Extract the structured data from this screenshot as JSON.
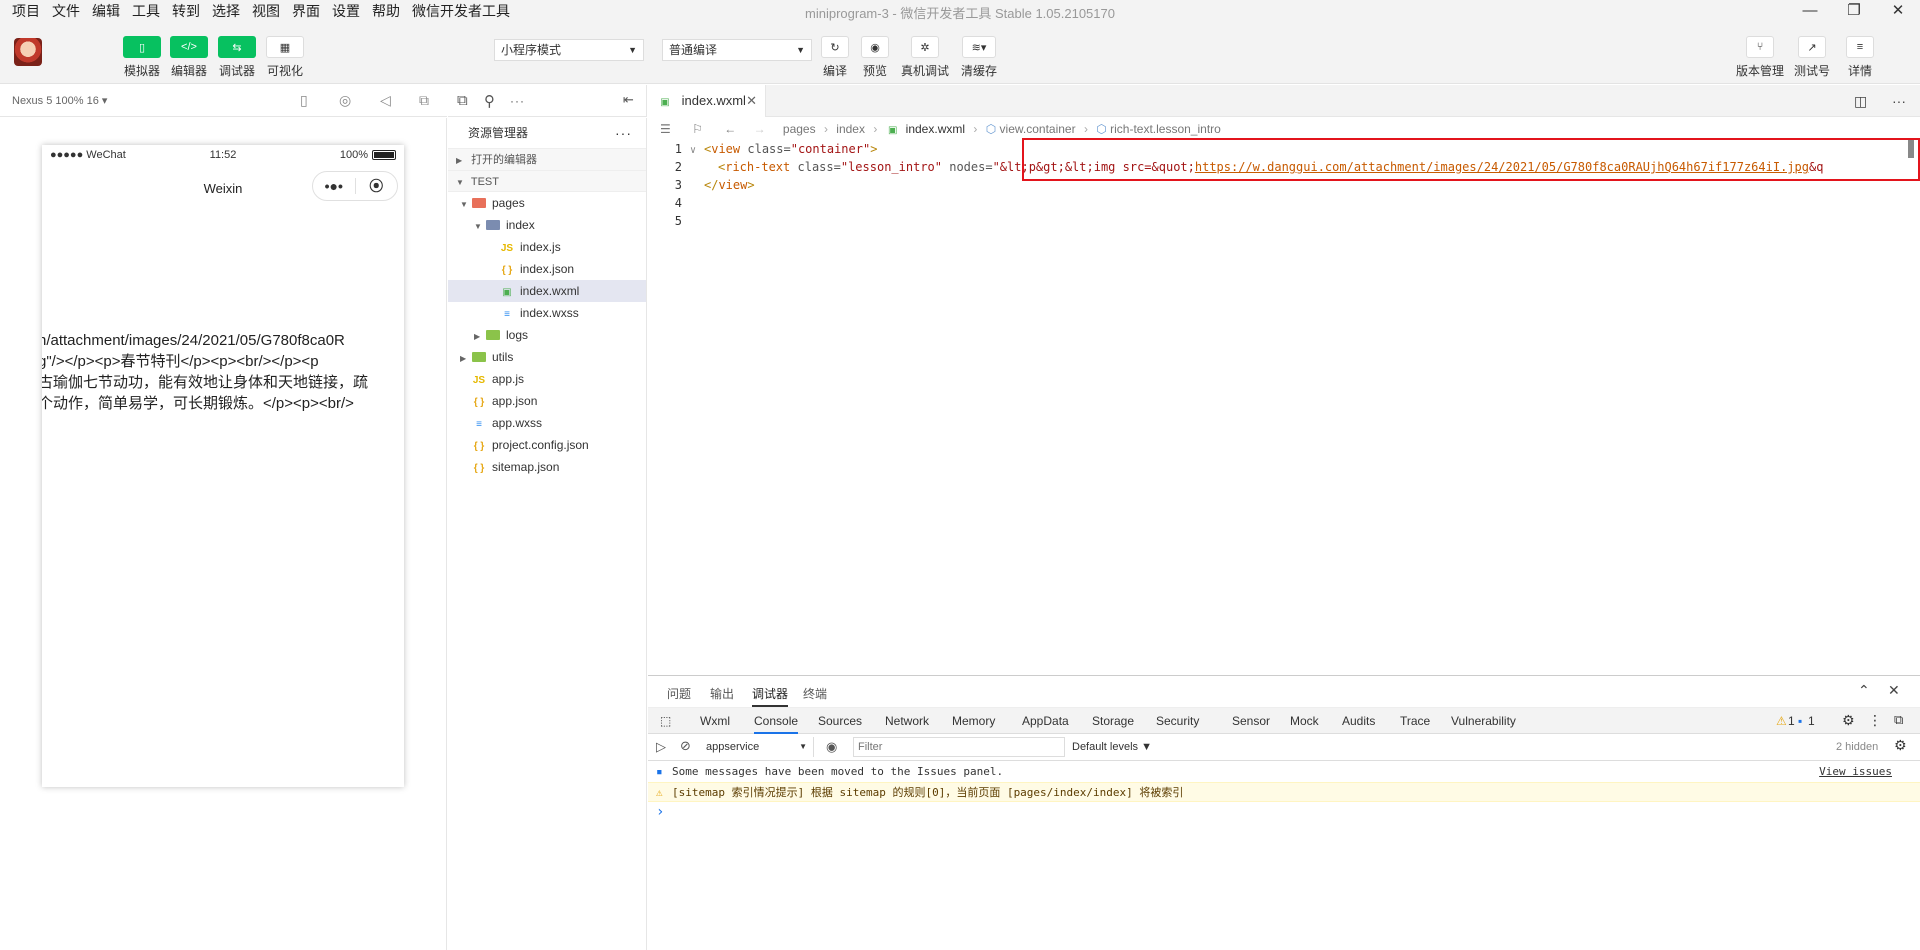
{
  "menu": [
    "项目",
    "文件",
    "编辑",
    "工具",
    "转到",
    "选择",
    "视图",
    "界面",
    "设置",
    "帮助",
    "微信开发者工具"
  ],
  "window_title": "miniprogram-3 - 微信开发者工具 Stable 1.05.2105170",
  "toolbar": {
    "left_buttons": [
      {
        "label": "模拟器",
        "icon": "phone-icon"
      },
      {
        "label": "编辑器",
        "icon": "code-icon"
      },
      {
        "label": "调试器",
        "icon": "debug-icon"
      },
      {
        "label": "可视化",
        "icon": "layout-icon"
      }
    ],
    "mode_select": "小程序模式",
    "compile_select": "普通编译",
    "center_buttons": [
      {
        "label": "编译",
        "icon": "refresh-icon"
      },
      {
        "label": "预览",
        "icon": "eye-icon"
      },
      {
        "label": "真机调试",
        "icon": "bug-icon"
      },
      {
        "label": "清缓存",
        "icon": "layers-icon"
      }
    ],
    "right_buttons": [
      {
        "label": "版本管理",
        "icon": "branch-icon"
      },
      {
        "label": "测试号",
        "icon": "external-icon"
      },
      {
        "label": "详情",
        "icon": "menu-icon"
      }
    ]
  },
  "simulator": {
    "device": "Nexus 5 100% 16 ▾",
    "status": {
      "carrier": "●●●●● WeChat",
      "time": "11:52",
      "battery": "100%"
    },
    "nav_title": "Weixin",
    "content_lines": [
      "n/attachment/images/24/2021/05/G780f8ca0R",
      "g\"/></p><p>春节特刊</p><p><br/></p><p",
      "古瑜伽七节动功，能有效地让身体和天地链接，疏",
      "个动作，简单易学，可长期锻炼。</p><p><br/>"
    ]
  },
  "explorer": {
    "title": "资源管理器",
    "open_editors": "打开的编辑器",
    "project": "TEST",
    "tree": [
      {
        "name": "pages",
        "type": "folder-red",
        "depth": 1,
        "expanded": true
      },
      {
        "name": "index",
        "type": "folder",
        "depth": 2,
        "expanded": true
      },
      {
        "name": "index.js",
        "type": "js",
        "depth": 3
      },
      {
        "name": "index.json",
        "type": "json",
        "depth": 3
      },
      {
        "name": "index.wxml",
        "type": "wxml",
        "depth": 3,
        "selected": true
      },
      {
        "name": "index.wxss",
        "type": "wxss",
        "depth": 3
      },
      {
        "name": "logs",
        "type": "folder-green",
        "depth": 2,
        "expanded": false
      },
      {
        "name": "utils",
        "type": "folder-green",
        "depth": 1,
        "expanded": false
      },
      {
        "name": "app.js",
        "type": "js",
        "depth": 1
      },
      {
        "name": "app.json",
        "type": "json",
        "depth": 1
      },
      {
        "name": "app.wxss",
        "type": "wxss",
        "depth": 1
      },
      {
        "name": "project.config.json",
        "type": "json",
        "depth": 1
      },
      {
        "name": "sitemap.json",
        "type": "json",
        "depth": 1
      }
    ]
  },
  "editor": {
    "tab": "index.wxml",
    "breadcrumb": [
      "pages",
      "index",
      "index.wxml",
      "view.container",
      "rich-text.lesson_intro"
    ],
    "lines": [
      {
        "n": "1",
        "fold": "∨",
        "open": "<",
        "tag": "view",
        "attr": " class=",
        "val": "\"container\"",
        "close": ">"
      },
      {
        "n": "2",
        "indent": true,
        "open": "<",
        "tag": "rich-text",
        "attr": " class=",
        "val": "\"lesson_intro\"",
        "attr2": " nodes=",
        "val2": "\"&lt;p&gt;&lt;img src=&quot;",
        "url": "https://w.danggui.com/attachment/images/24/2021/05/G780f8ca0RAUjhQ64h67if177z64iI.jpg",
        "tail": "&q"
      },
      {
        "n": "3",
        "open": "</",
        "tag": "view",
        "close": ">"
      },
      {
        "n": "4"
      },
      {
        "n": "5"
      }
    ]
  },
  "devtools": {
    "top_tabs": [
      "问题",
      "输出",
      "调试器",
      "终端"
    ],
    "active_top": "调试器",
    "panels": [
      "Wxml",
      "Console",
      "Sources",
      "Network",
      "Memory",
      "AppData",
      "Storage",
      "Security",
      "Sensor",
      "Mock",
      "Audits",
      "Trace",
      "Vulnerability"
    ],
    "active_panel": "Console",
    "badges": {
      "warnings": "1",
      "messages": "1"
    },
    "context": "appservice",
    "filter_placeholder": "Filter",
    "levels": "Default levels ▼",
    "hidden": "2 hidden",
    "messages": [
      {
        "type": "info",
        "text": "Some messages have been moved to the Issues panel.",
        "link": "View issues"
      },
      {
        "type": "warn",
        "text": "[sitemap 索引情况提示] 根据 sitemap 的规则[0]，当前页面 [pages/index/index] 将被索引"
      }
    ],
    "prompt": "›"
  }
}
